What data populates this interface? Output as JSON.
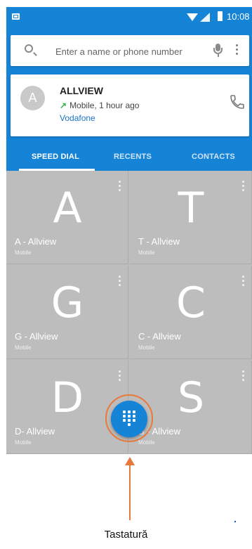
{
  "status_bar": {
    "time": "10:08",
    "icons": [
      "sim-card-icon",
      "wifi-icon",
      "signal-icon",
      "battery-icon"
    ]
  },
  "search": {
    "placeholder": "Enter a name or phone number",
    "icons": [
      "search-icon",
      "microphone-icon",
      "more-vert-icon"
    ]
  },
  "recent_contact": {
    "avatar_letter": "A",
    "name": "ALLVIEW",
    "detail": "Mobile, 1 hour ago",
    "carrier": "Vodafone",
    "call_direction_icon": "outgoing-call-arrow-icon",
    "action_icon": "phone-icon"
  },
  "tabs": [
    {
      "label": "SPEED DIAL",
      "active": true
    },
    {
      "label": "RECENTS",
      "active": false
    },
    {
      "label": "CONTACTS",
      "active": false
    }
  ],
  "speed_dial": [
    {
      "letter": "A",
      "name": "A - Allview",
      "type": "Mobile"
    },
    {
      "letter": "T",
      "name": "T - Allview",
      "type": "Mobile"
    },
    {
      "letter": "G",
      "name": "G - Allview",
      "type": "Mobile"
    },
    {
      "letter": "C",
      "name": "C - Allview",
      "type": "Mobile"
    },
    {
      "letter": "D",
      "name": "D- Allview",
      "type": "Mobile"
    },
    {
      "letter": "S",
      "name": "S - Allview",
      "type": "Mobile"
    }
  ],
  "fab": {
    "icon": "dialpad-icon"
  },
  "annotation": {
    "caption": "Tastatură"
  },
  "colors": {
    "primary": "#1684d6",
    "tile": "#bdbdbd",
    "callout": "#e8793a",
    "carrier_link": "#1a73c7",
    "outgoing_arrow": "#2fb24c"
  }
}
